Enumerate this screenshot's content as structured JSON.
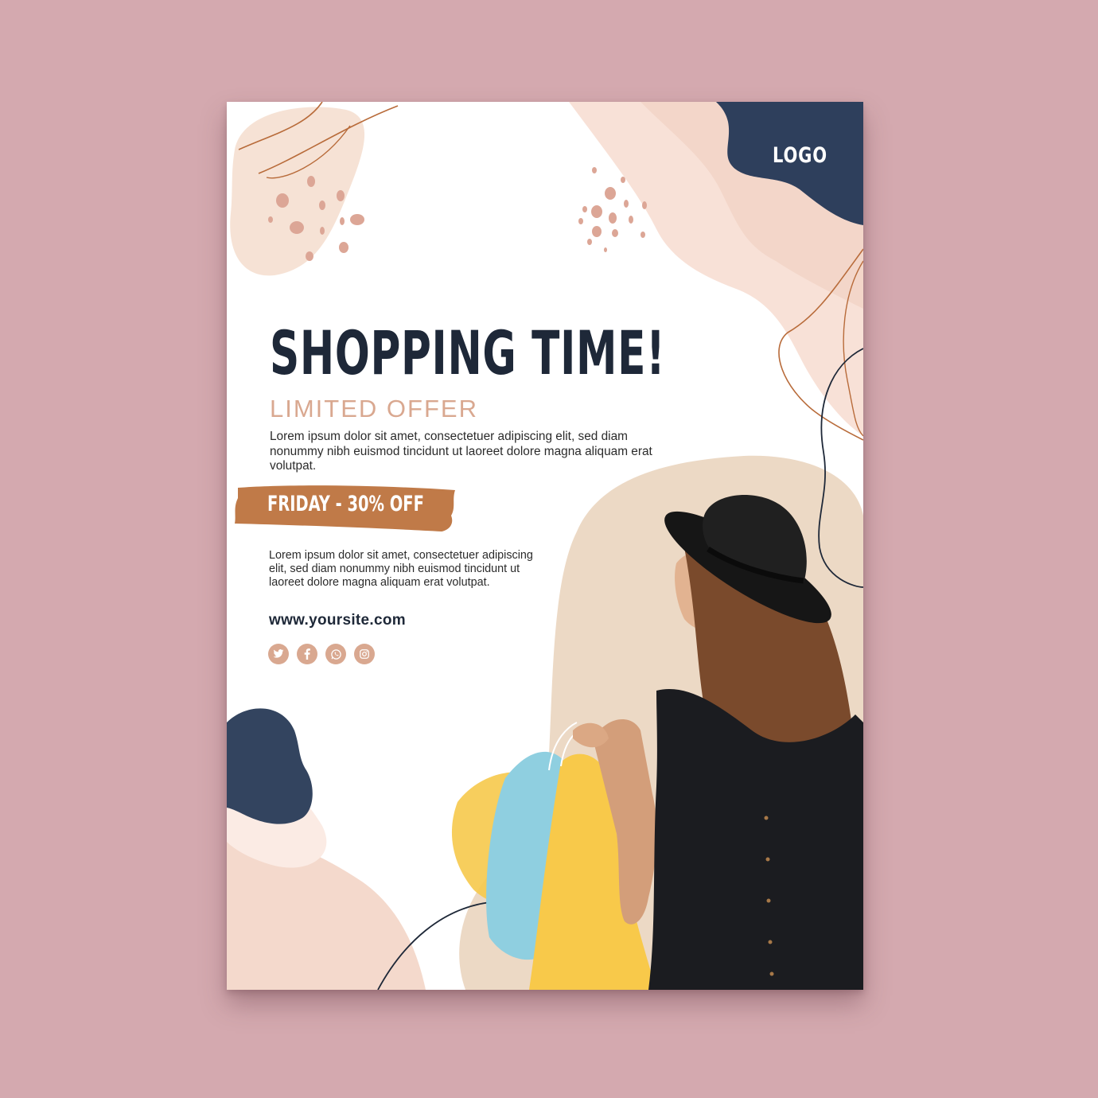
{
  "poster": {
    "logo": "LOGO",
    "headline": "SHOPPING TIME!",
    "subheadline": "LIMITED OFFER",
    "intro_text": "Lorem ipsum dolor sit amet, consectetuer adipiscing elit, sed diam nonummy nibh euismod tincidunt ut laoreet dolore magna aliquam erat volutpat.",
    "promo_banner": "FRIDAY - 30% OFF",
    "detail_text": "Lorem ipsum dolor sit amet, consectetuer adipiscing elit, sed diam nonummy nibh euismod tincidunt ut laoreet dolore magna aliquam erat volutpat.",
    "website": "www.yoursite.com",
    "social_icons": [
      "twitter-icon",
      "facebook-icon",
      "whatsapp-icon",
      "instagram-icon"
    ]
  },
  "colors": {
    "page_background": "#d4a9af",
    "navy": "#2e3f5c",
    "headline": "#1e2838",
    "accent_peach": "#d9a890",
    "banner_copper": "#c07a48",
    "blush": "#f7e3d8"
  }
}
